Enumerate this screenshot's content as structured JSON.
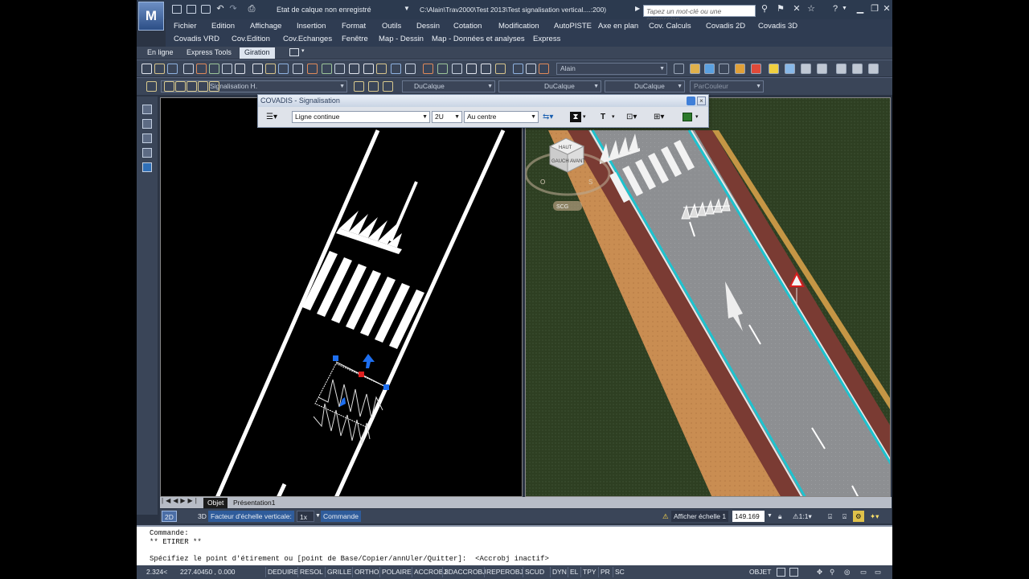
{
  "titlebar": {
    "logo_letter": "M",
    "layer_state": "Etat de calque non enregistré",
    "doc_path": "C:\\Alain\\Trav2000\\Test 2013\\Test signalisation vertical....:200)",
    "search_placeholder": "Tapez un mot-clé ou une expression",
    "help": "?"
  },
  "menu": {
    "row1": [
      "Fichier",
      "Edition",
      "Affichage",
      "Insertion",
      "Format",
      "Outils",
      "Dessin",
      "Cotation",
      "Modification",
      "AutoPISTE",
      "Axe en plan",
      "Cov. Calculs",
      "Covadis 2D",
      "Covadis 3D"
    ],
    "row2": [
      "Covadis VRD",
      "Cov.Edition",
      "Cov.Echanges",
      "Fenêtre",
      "Map - Dessin",
      "Map - Données et analyses",
      "Express"
    ]
  },
  "ribbon_tabs": [
    "En ligne",
    "Express Tools",
    "Giration"
  ],
  "active_tab": "Giration",
  "toolbar1": {
    "user_combo": "Alain"
  },
  "toolbar2": {
    "layer_combo": "Signalisation H.",
    "color_combo": "DuCalque",
    "linetype_combo": "DuCalque",
    "lineweight_combo": "DuCalque",
    "plotstyle_combo": "ParCouleur"
  },
  "covadis": {
    "title": "COVADIS - Signalisation",
    "line_type": "Ligne continue",
    "width": "2U",
    "position": "Au centre",
    "text_icon": "T"
  },
  "viewcube": {
    "face_top": "HAUT",
    "face_left": "GAUCH",
    "face_front": "AVANT",
    "south": "S",
    "west": "O",
    "ucs": "SCG"
  },
  "layout_tabs": [
    "Objet",
    "Présentation1"
  ],
  "status_bar_top": {
    "btn_2d": "2D",
    "btn_3d": "3D",
    "factor_label": "Facteur d'échelle verticale:",
    "factor_value": "1x",
    "command_label": "Commande",
    "annot_label": "Afficher échelle 1",
    "scale_value": "149.169",
    "ratio": "1:1"
  },
  "command_lines": [
    "Commande:",
    "** ETIRER **",
    "",
    "Spécifiez le point d'étirement ou [point de Base/Copier/annUler/Quitter]:  <Accrobj inactif>"
  ],
  "status_bar_bottom": {
    "coords_x": "2.324<",
    "coords_rest": "227.40450 , 0.000",
    "toggles": [
      "DEDUIRE",
      "RESOL",
      "GRILLE",
      "ORTHO",
      "POLAIRE",
      "ACCROBJ",
      "3DACCROBJ",
      "REPEROBJ",
      "SCUD",
      "DYN",
      "EL",
      "TPY",
      "PR",
      "SC"
    ],
    "space": "OBJET"
  },
  "colors": {
    "title_bg": "#2c3a4f",
    "toolbar_bg": "#3a4558",
    "grass": "#2e3f22",
    "road": "#8d8f92",
    "bike_lane": "#7a3b33",
    "sidewalk": "#c98d52",
    "curb_cyan": "#1ec3cf",
    "grip_blue": "#1e6ff0",
    "grip_red": "#e01f1f"
  }
}
